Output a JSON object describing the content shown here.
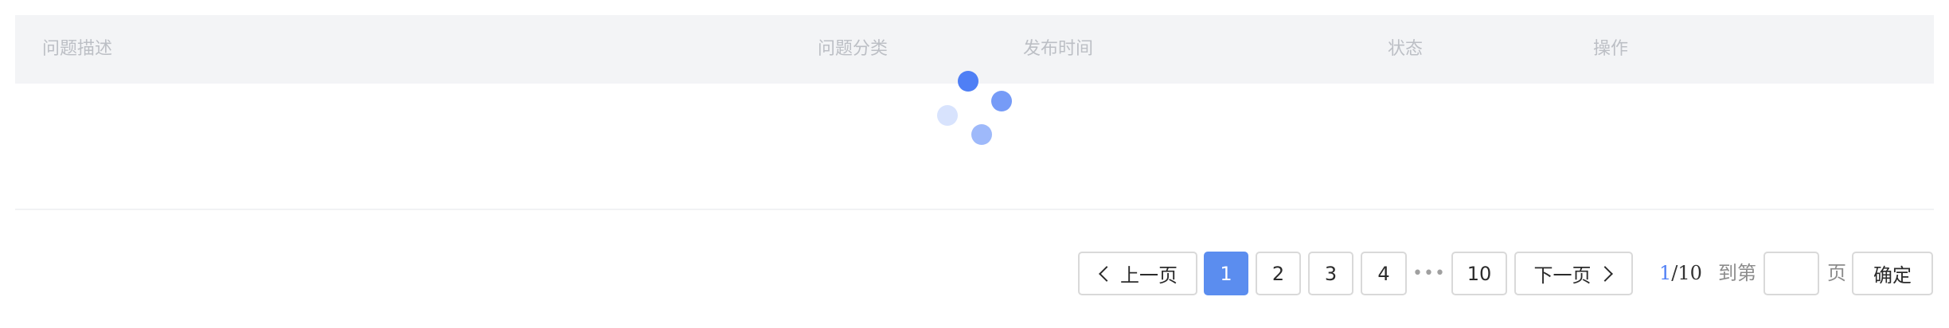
{
  "table": {
    "columns": [
      "问题描述",
      "问题分类",
      "发布时间",
      "状态",
      "操作"
    ]
  },
  "loading": {
    "icon": "loading-spinner-icon",
    "color": "#4f7ff5"
  },
  "pagination": {
    "prev_label": "上一页",
    "next_label": "下一页",
    "pages": [
      "1",
      "2",
      "3",
      "4",
      "10"
    ],
    "ellipsis": "•••",
    "active_page": "1",
    "current_page": "1",
    "total_display": "/10",
    "goto_prefix": "到第",
    "goto_suffix": "页",
    "goto_value": "",
    "confirm_label": "确定",
    "accent_color": "#5b8def"
  }
}
